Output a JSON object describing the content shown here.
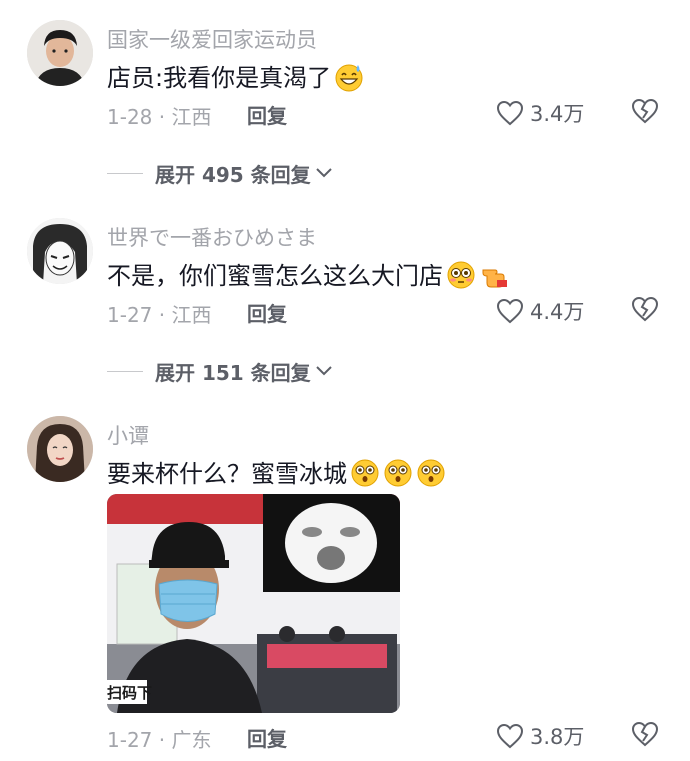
{
  "comments": [
    {
      "username": "国家一级爱回家运动员",
      "text": "店员:我看你是真渴了",
      "date_location": "1-28 · 江西",
      "reply_label": "回复",
      "likes": "3.4万",
      "expand_label": "展开 495 条回复"
    },
    {
      "username": "世界で一番おひめさま",
      "text": "不是，你们蜜雪怎么这么大门店",
      "date_location": "1-27 · 江西",
      "reply_label": "回复",
      "likes": "4.4万",
      "expand_label": "展开 151 条回复"
    },
    {
      "username": "小谭",
      "text": "要来杯什么？蜜雪冰城",
      "date_location": "1-27 · 广东",
      "reply_label": "回复",
      "likes": "3.8万"
    }
  ],
  "photo_sign_text": "扫码下",
  "colors": {
    "muted_text": "#a3a5ab",
    "action_text": "#5c5f67",
    "body_text": "#161823",
    "emoji_yellow": "#ffcc33"
  }
}
